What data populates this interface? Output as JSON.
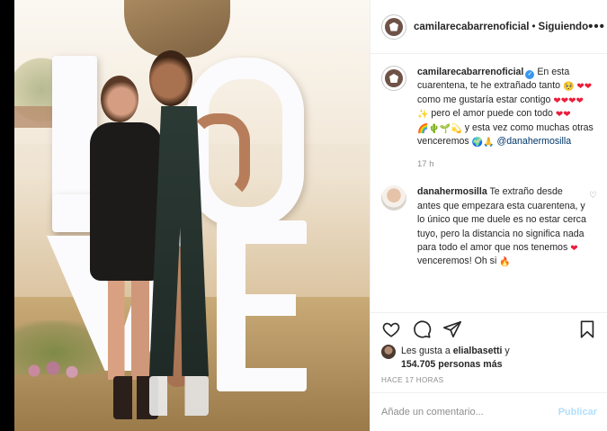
{
  "header": {
    "username": "camilarecabarrenoficial",
    "separator": "•",
    "follow_status": "Siguiendo",
    "more_label": "•••"
  },
  "caption": {
    "username": "camilarecabarrenoficial",
    "verified_glyph": "✓",
    "text_1": " En esta cuarentena, te he extrañado tanto ",
    "emoji_1": "🥺",
    "emoji_2": "❤❤",
    "text_2": "como me gustaría estar contigo ",
    "emoji_3": "❤❤❤❤",
    "emoji_4": "✨",
    "text_3": " pero el amor puede con todo ",
    "emoji_5": "❤❤",
    "emoji_6": "🌈🌵🌱💫",
    "text_4": " y esta vez como muchas otras venceremos ",
    "emoji_7": "🌍🙏",
    "mention": " @danahermosilla",
    "time": "17 h"
  },
  "comment": {
    "username": "danahermosilla",
    "text_1": " Te extraño desde antes que empezara esta cuarentena, y lo único que me duele es no estar cerca tuyo, pero la distancia no significa nada para todo el amor que nos tenemos ",
    "emoji_1": "❤",
    "text_2": " venceremos! Oh si ",
    "emoji_2": "🔥",
    "like_glyph": "♡"
  },
  "likes": {
    "prefix": "Les gusta a ",
    "user": "elialbasetti",
    "middle": " y",
    "count": "154.705 personas más"
  },
  "date": "HACE 17 HORAS",
  "add_comment": {
    "placeholder": "Añade un comentario...",
    "publish_label": "Publicar"
  },
  "icons": {
    "like": "heart-outline-icon",
    "comment": "comment-bubble-icon",
    "share": "paper-plane-icon",
    "save": "bookmark-icon"
  },
  "colors": {
    "link": "#00376b",
    "verified": "#3897f0",
    "heart": "#ed1c3a",
    "publish_disabled": "#b2dffc"
  }
}
